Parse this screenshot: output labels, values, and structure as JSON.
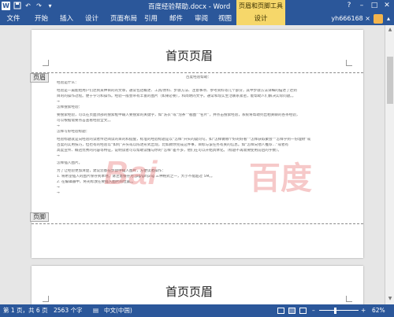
{
  "titlebar": {
    "doc_title": "百度经验帮助.docx - Word",
    "context_group": "页眉和页脚工具",
    "help_icon": "?",
    "minimize_icon": "–",
    "restore_icon": "□",
    "close_icon": "✕"
  },
  "ribbon": {
    "file_tab": "文件",
    "tabs": [
      "开始",
      "插入",
      "设计",
      "页面布局",
      "引用",
      "邮件",
      "审阅",
      "视图"
    ],
    "context_tab": "设计",
    "user": "yh666168 ×"
  },
  "page1": {
    "header_text": "首页页眉",
    "header_label": "页眉",
    "footer_label": "页脚",
    "body_lines": [
      "百度经验帮助：",
      "经验是什么：",
      "经验是一篇能给用户们达到某种目的的文章，通常包括概述、工具/原料、步骤方法、注意事项、参考资料等几个部分，其中步骤方法详细的描述了达到",
      "目的的操作过程。便于学习和操作。经验一般会带有丰富的图片（如果必要），和简明的文字。通常和现实生活联系紧密，能帮助人们解决实际问题。。",
      "→",
      "怎样搜索经验：",
      "要搜索经验，可以在页面顶部的搜索框中输入要搜索的关键字，如“洗衣”或“泡茶”“截图”“名片”，并点击搜索经验，系统将帮助列出相关联的各条经验，",
      "可以根据需要点击查看经验全文。。",
      "→",
      "怎样写好经验标题：",
      "经验标题就是向经验的读者传达阅读的目的和提醒，标准的经验标题是以“怎样”开头的疑问句，如“怎样做哪个好的好看”“怎样获取聚会”“怎样学到一份理财”或",
      "百度的实用技巧，但也有的经验以“如何”开头或以陈述形式出现，比如教你完成这件事，目标与该任务有关的信息。如“怎样向他人推荐...”或者有",
      "高度宣传、概括优秀的内容等特征，说明读者可以帮助读懂与你的“怎样”差不多，他们在可以开始具体化。（标题不再需要使用前后的字数）。",
      "→",
      "怎样插入图片。",
      "为了让经验更加清楚，建议您都在步骤中插入图片，方便读者操作：",
      "1. 将希望插入的图片保存到本地，请注意保存为 jpg/gif/png 三种格式之一，大小不能超过 5M。。",
      "2. 在编辑器中，将光标放在要插入图片的位置。。",
      "→",
      "→"
    ]
  },
  "watermark": {
    "latin": "Bai",
    "cjk": "百度"
  },
  "page2": {
    "header_text": "首页页眉"
  },
  "statusbar": {
    "page": "第 1 页，共 6 页",
    "words": "2563 个字",
    "language": "中文(中国)",
    "zoom": "62%",
    "zoom_minus": "–",
    "zoom_plus": "+"
  },
  "colors": {
    "word_blue": "#2b579a",
    "context_yellow": "#f6d76a",
    "watermark_red": "#dd3c3c"
  },
  "icons": {
    "app": "word-icon",
    "save": "save-icon",
    "undo": "undo-icon",
    "redo": "redo-icon"
  }
}
